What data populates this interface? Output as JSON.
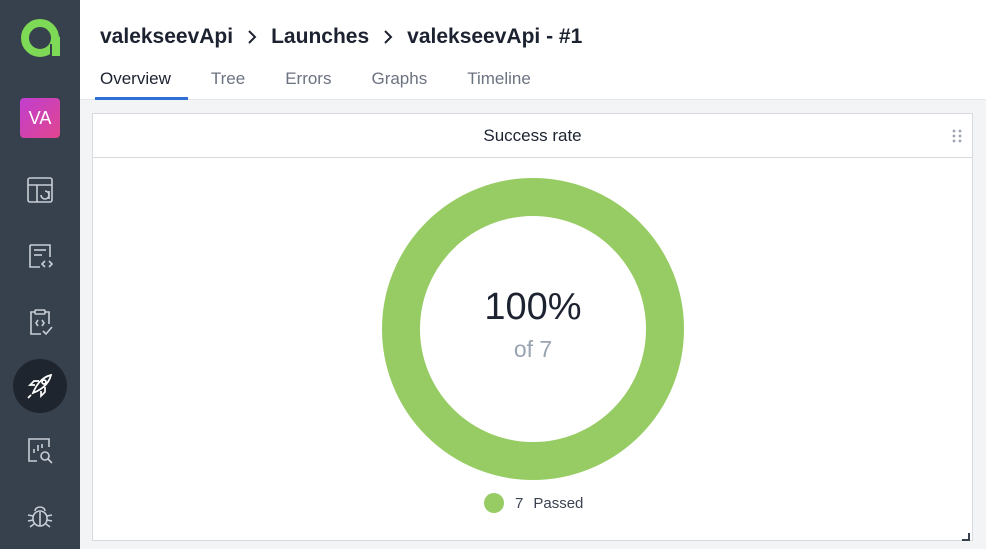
{
  "sidebar": {
    "project_initials": "VA",
    "items": [
      {
        "name": "dashboards",
        "icon": "dashboard-icon",
        "active": false
      },
      {
        "name": "test-cases",
        "icon": "code-document-icon",
        "active": false
      },
      {
        "name": "test-plans",
        "icon": "clipboard-check-icon",
        "active": false
      },
      {
        "name": "launches",
        "icon": "rocket-icon",
        "active": true
      },
      {
        "name": "analytics",
        "icon": "chart-search-icon",
        "active": false
      },
      {
        "name": "defects",
        "icon": "bug-icon",
        "active": false
      }
    ]
  },
  "breadcrumb": {
    "project": "valekseevApi",
    "section": "Launches",
    "launch": "valekseevApi - #1"
  },
  "tabs": [
    {
      "label": "Overview",
      "active": true
    },
    {
      "label": "Tree",
      "active": false
    },
    {
      "label": "Errors",
      "active": false
    },
    {
      "label": "Graphs",
      "active": false
    },
    {
      "label": "Timeline",
      "active": false
    }
  ],
  "widget": {
    "title": "Success rate",
    "center_value": "100%",
    "center_sub": "of 7",
    "legend": [
      {
        "count": "7",
        "label": "Passed",
        "color": "#97cc64"
      }
    ]
  },
  "chart_data": {
    "type": "pie",
    "categories": [
      "Passed"
    ],
    "values": [
      7
    ],
    "colors": [
      "#97cc64"
    ],
    "title": "Success rate"
  },
  "colors": {
    "sidebar_bg": "#37404d",
    "active_nav_bg": "#1f252e",
    "accent_tab": "#2f6fd6",
    "passed": "#97cc64",
    "logo_green": "#7ed957"
  }
}
